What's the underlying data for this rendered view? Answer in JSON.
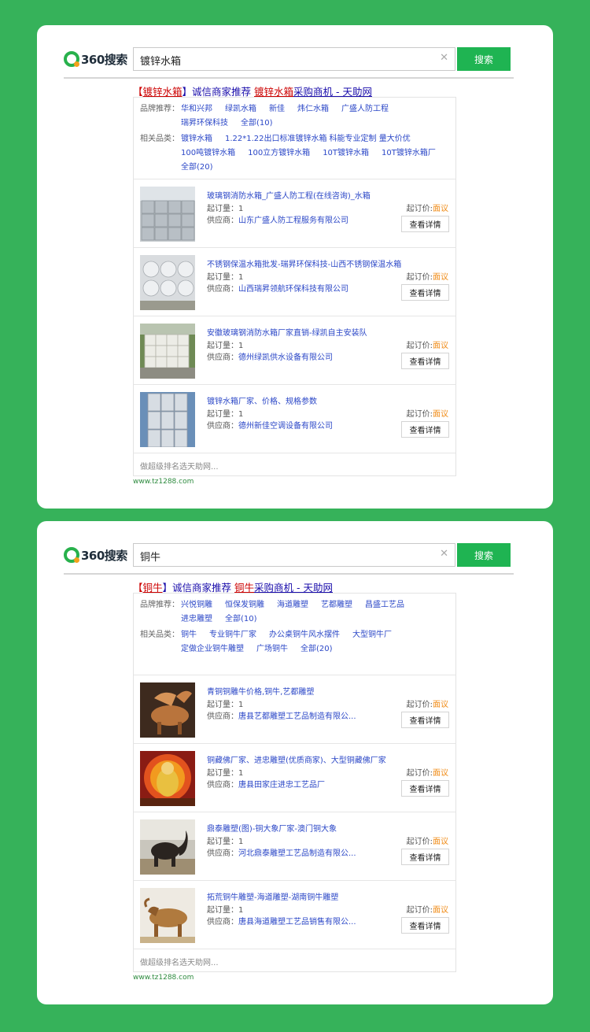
{
  "panels": [
    {
      "logo": "360搜索",
      "query": "镀锌水箱",
      "search_label": "搜索",
      "title": {
        "prefix": "【",
        "kw1": "镀锌水箱",
        "mid": "】诚信商家推荐 ",
        "kw2": "镀锌水箱",
        "suffix": "采购商机 - 天助网"
      },
      "brand_label": "品牌推荐：",
      "brands": [
        "华和兴邦",
        "绿凯水箱",
        "新佳",
        "炜仁水箱",
        "广盛人防工程",
        "瑞昇环保科技",
        "全部(10)"
      ],
      "related_label": "相关品类：",
      "related": [
        "镀锌水箱",
        "1.22*1.22出口标准镀锌水箱",
        "科能专业定制 量大价优",
        "100吨镀锌水箱",
        "100立方镀锌水箱",
        "10T镀锌水箱",
        "10T镀锌水箱厂",
        "全部(20)"
      ],
      "items": [
        {
          "name": "玻璃钢消防水箱_广盛人防工程(在线咨询)_水箱",
          "qty": "起订量：1",
          "sup_label": "供应商：",
          "supplier": "山东广盛人防工程服务有限公司",
          "price_label": "起订价:",
          "price": "面议",
          "btn": "查看详情"
        },
        {
          "name": "不锈钢保温水箱批发-瑞昇环保科技-山西不锈钢保温水箱",
          "qty": "起订量：1",
          "sup_label": "供应商：",
          "supplier": "山西瑞昇领航环保科技有限公司",
          "price_label": "起订价:",
          "price": "面议",
          "btn": "查看详情"
        },
        {
          "name": "安徽玻璃钢消防水箱厂家直销-绿凯自主安装队",
          "qty": "起订量：1",
          "sup_label": "供应商：",
          "supplier": "德州绿凯供水设备有限公司",
          "price_label": "起订价:",
          "price": "面议",
          "btn": "查看详情"
        },
        {
          "name": "镀锌水箱厂家、价格、规格参数",
          "qty": "起订量：1",
          "sup_label": "供应商：",
          "supplier": "德州新佳空调设备有限公司",
          "price_label": "起订价:",
          "price": "面议",
          "btn": "查看详情"
        }
      ],
      "more": "做超级排名选天助网...",
      "site": "www.tz1288.com"
    },
    {
      "logo": "360搜索",
      "query": "铜牛",
      "search_label": "搜索",
      "title": {
        "prefix": "【",
        "kw1": "铜牛",
        "mid": "】诚信商家推荐 ",
        "kw2": "铜牛",
        "suffix": "采购商机 - 天助网"
      },
      "brand_label": "品牌推荐：",
      "brands": [
        "兴悦铜雕",
        "恒保发铜雕",
        "海道雕塑",
        "艺都雕塑",
        "昌盛工艺品",
        "进忠雕塑",
        "全部(10)"
      ],
      "related_label": "相关品类：",
      "related": [
        "铜牛",
        "专业铜牛厂家",
        "办公桌铜牛风水摆件",
        "大型铜牛厂",
        "定做企业铜牛雕塑",
        "广场铜牛",
        "全部(20)"
      ],
      "items": [
        {
          "name": "青铜铜雕牛价格,铜牛,艺都雕塑",
          "qty": "起订量：1",
          "sup_label": "供应商：",
          "supplier": "唐县艺都雕塑工艺品制造有限公...",
          "price_label": "起订价:",
          "price": "面议",
          "btn": "查看详情"
        },
        {
          "name": "铜藏佛厂家、进忠雕塑(优质商家)、大型铜藏佛厂家",
          "qty": "起订量：1",
          "sup_label": "供应商：",
          "supplier": "唐县田家庄进忠工艺品厂",
          "price_label": "起订价:",
          "price": "面议",
          "btn": "查看详情"
        },
        {
          "name": "鼎泰雕塑(图)-铜大象厂家-澳门铜大象",
          "qty": "起订量：1",
          "sup_label": "供应商：",
          "supplier": "河北鼎泰雕塑工艺品制造有限公...",
          "price_label": "起订价:",
          "price": "面议",
          "btn": "查看详情"
        },
        {
          "name": "拓荒铜牛雕塑-海道雕塑-湖南铜牛雕塑",
          "qty": "起订量：1",
          "sup_label": "供应商：",
          "supplier": "唐县海道雕塑工艺品销售有限公...",
          "price_label": "起订价:",
          "price": "面议",
          "btn": "查看详情"
        }
      ],
      "more": "做超级排名选天助网...",
      "site": "www.tz1288.com"
    }
  ]
}
